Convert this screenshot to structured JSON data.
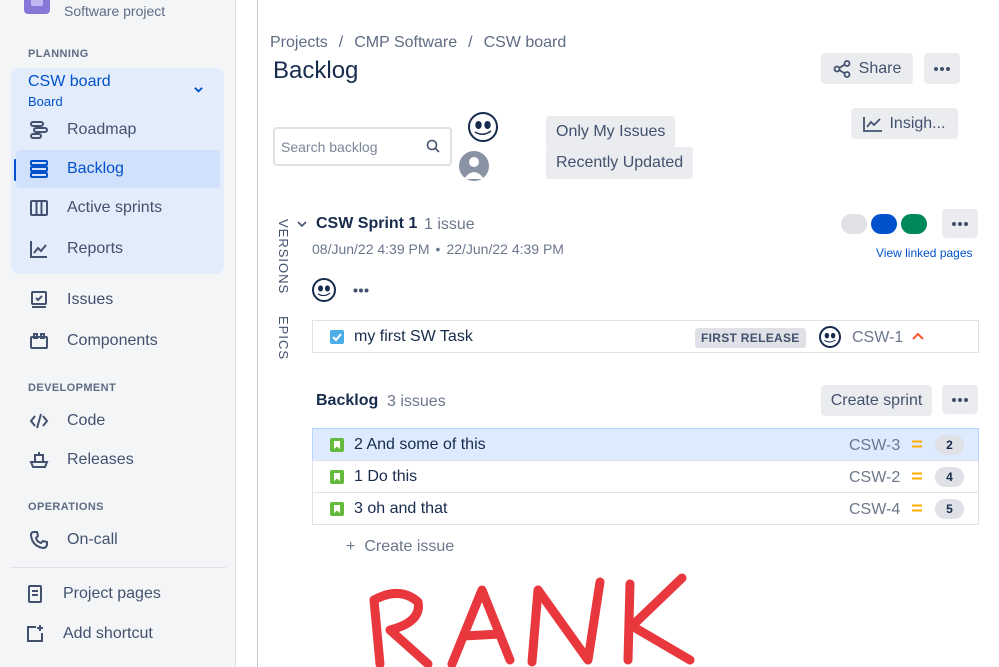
{
  "sidebar": {
    "project_type": "Software project",
    "sections": {
      "planning": "PLANNING",
      "development": "DEVELOPMENT",
      "operations": "OPERATIONS"
    },
    "board": {
      "title": "CSW board",
      "subtitle": "Board"
    },
    "items": {
      "roadmap": "Roadmap",
      "backlog": "Backlog",
      "active_sprints": "Active sprints",
      "reports": "Reports",
      "issues": "Issues",
      "components": "Components",
      "code": "Code",
      "releases": "Releases",
      "on_call": "On-call",
      "project_pages": "Project pages",
      "add_shortcut": "Add shortcut"
    },
    "active_item": "Backlog"
  },
  "header": {
    "breadcrumb": [
      "Projects",
      "CMP Software",
      "CSW board"
    ],
    "breadcrumb_sep": "/",
    "title": "Backlog",
    "share_label": "Share",
    "insights_label": "Insigh..."
  },
  "toolbar": {
    "search_placeholder": "Search backlog",
    "filters": [
      "Only My Issues",
      "Recently Updated"
    ]
  },
  "side_tabs": {
    "versions": "VERSIONS",
    "epics": "EPICS"
  },
  "sprint": {
    "name": "CSW Sprint 1",
    "count": "1 issue",
    "start": "08/Jun/22 4:39 PM",
    "date_sep": "•",
    "end": "22/Jun/22 4:39 PM",
    "view_linked": "View linked pages",
    "status_colors": [
      "#dfe1e6",
      "#0052cc",
      "#00875a"
    ],
    "issues": [
      {
        "summary": "my first SW Task",
        "epic": "FIRST RELEASE",
        "key": "CSW-1",
        "type": "task",
        "priority": "high"
      }
    ]
  },
  "backlog": {
    "title": "Backlog",
    "count": "3 issues",
    "create_sprint_label": "Create sprint",
    "create_issue_label": "Create issue",
    "issues": [
      {
        "summary": "2 And some of this",
        "key": "CSW-3",
        "estimate": "2",
        "type": "story",
        "priority": "medium",
        "selected": true
      },
      {
        "summary": "1 Do this",
        "key": "CSW-2",
        "estimate": "4",
        "type": "story",
        "priority": "medium",
        "selected": false
      },
      {
        "summary": "3 oh and that",
        "key": "CSW-4",
        "estimate": "5",
        "type": "story",
        "priority": "medium",
        "selected": false
      }
    ]
  },
  "annotation": {
    "text": "RANK",
    "color": "#e8373d"
  },
  "colors": {
    "accent": "#0052cc",
    "story": "#63ba3c",
    "task": "#4bade8",
    "priority_medium": "#ffab00",
    "priority_high": "#ff5630"
  }
}
